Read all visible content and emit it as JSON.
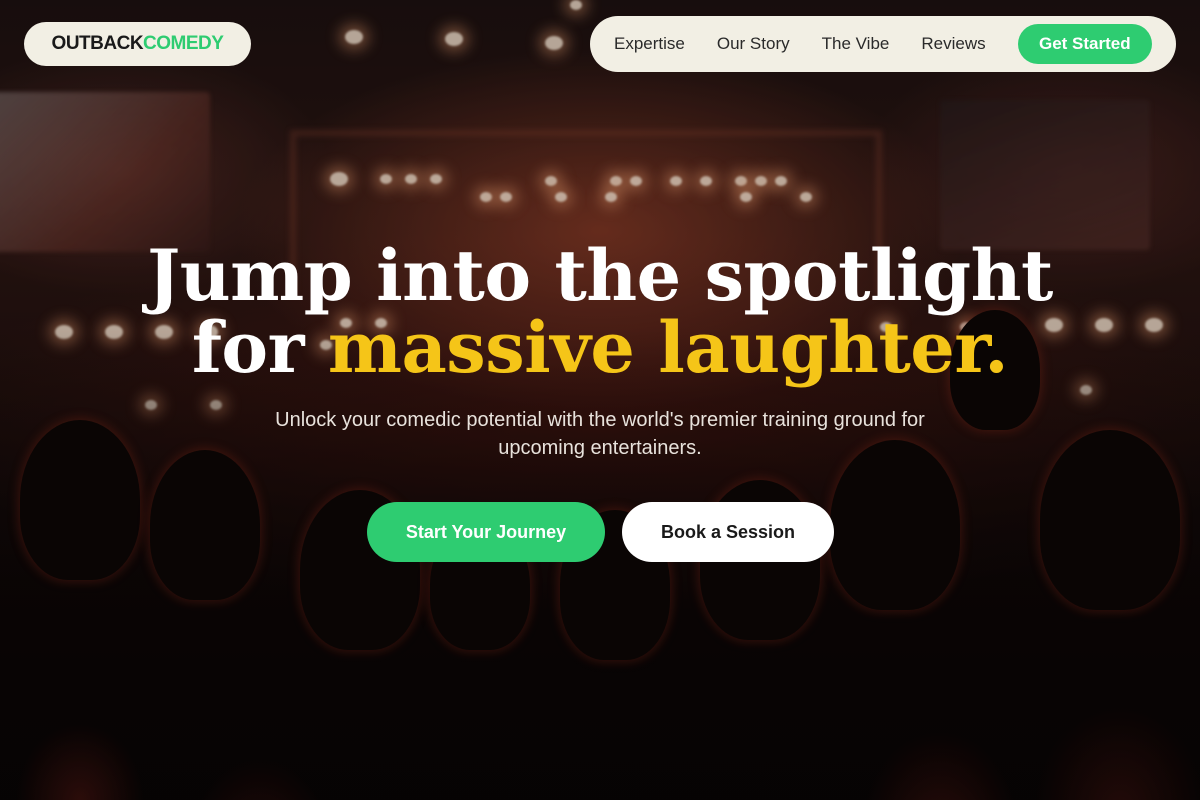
{
  "brand": {
    "name_primary": "OUTBACK",
    "name_accent": "COMEDY",
    "accent_color": "#2ecc71",
    "pill_color": "#f2efe4"
  },
  "nav": {
    "items": [
      {
        "label": "Expertise"
      },
      {
        "label": "Our Story"
      },
      {
        "label": "The Vibe"
      },
      {
        "label": "Reviews"
      }
    ],
    "cta_label": "Get Started"
  },
  "hero": {
    "headline_line1": "Jump into the spotlight",
    "headline_line2_prefix": "for ",
    "headline_line2_highlight": "massive laughter.",
    "highlight_color": "#f5c518",
    "subtext": "Unlock your comedic potential with the world's premier training ground for upcoming entertainers.",
    "primary_button": "Start Your Journey",
    "secondary_button": "Book a Session",
    "background_image": "concert-crowd-stage-photo"
  }
}
